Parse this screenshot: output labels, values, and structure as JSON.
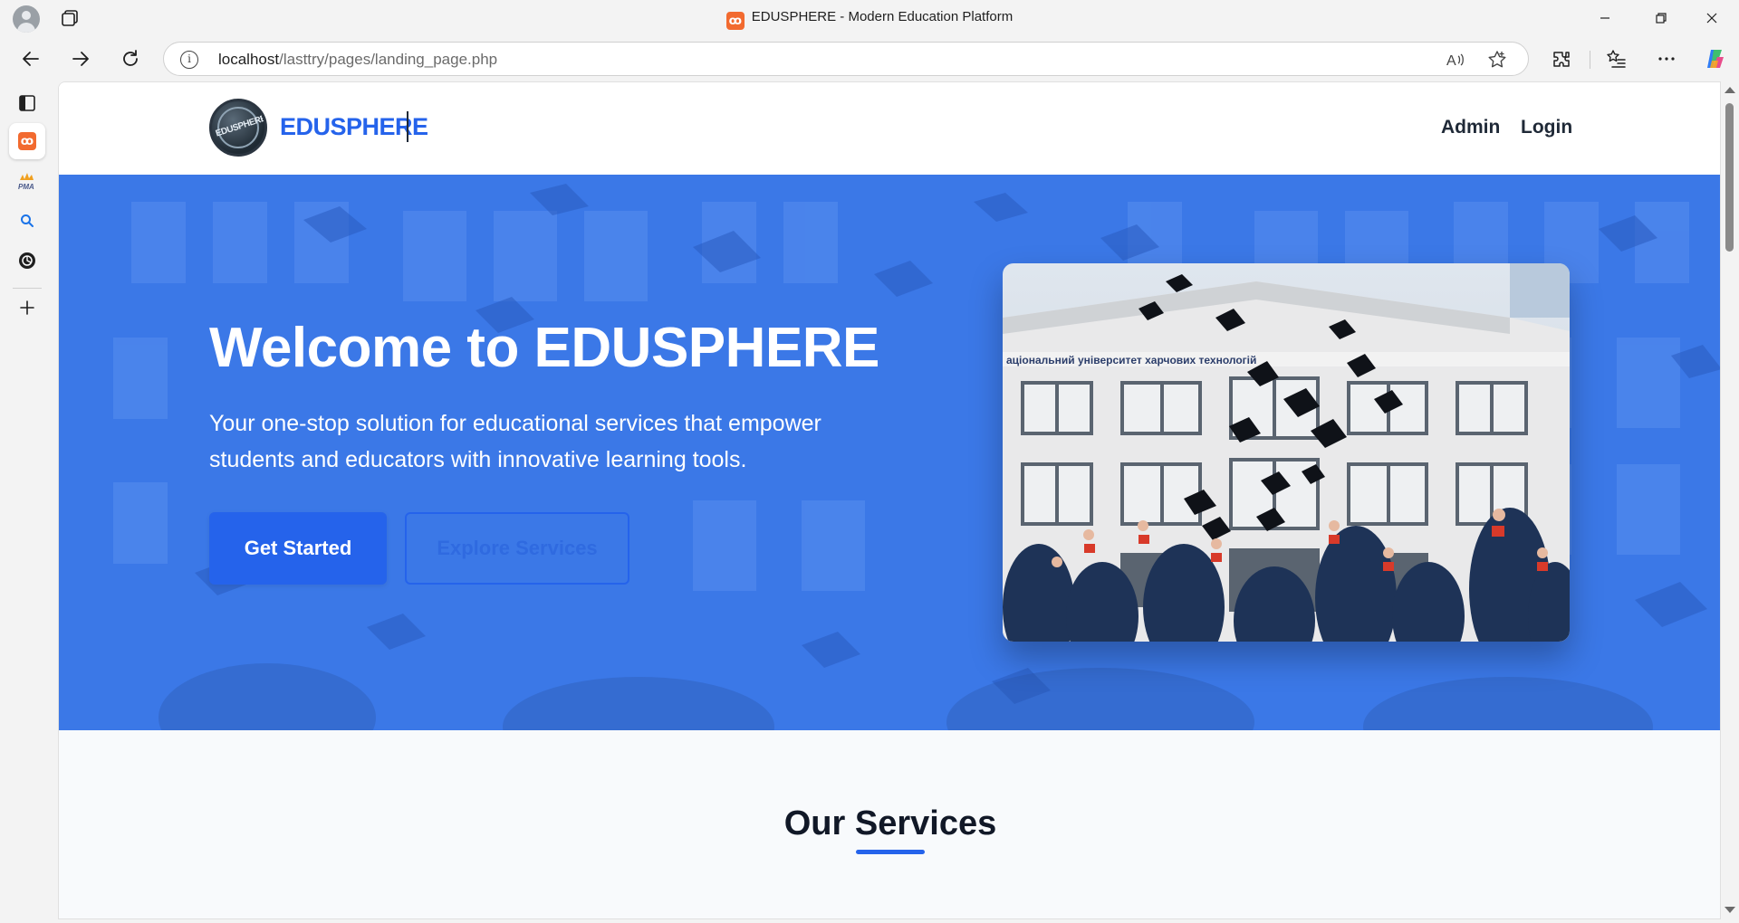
{
  "browser": {
    "window_title": "EDUSPHERE - Modern Education Platform",
    "url_host": "localhost",
    "url_path": "/lasttry/pages/landing_page.php"
  },
  "sidebar": {
    "items": [
      "vertical-tabs",
      "xampp",
      "phpmyadmin",
      "search",
      "openai",
      "add"
    ]
  },
  "site": {
    "brand": "EDUSPHERE",
    "logo_text": "EDUSPHERE",
    "nav": [
      {
        "label": "Admin"
      },
      {
        "label": "Login"
      }
    ]
  },
  "hero": {
    "title": "Welcome to EDUSPHERE",
    "subtitle": "Your one-stop solution for educational services that empower students and educators with innovative learning tools.",
    "primary_button": "Get Started",
    "secondary_button": "Explore Services"
  },
  "services": {
    "title": "Our Services"
  },
  "colors": {
    "brand_blue": "#2563eb",
    "hero_blue": "#3b78e7",
    "heading_dark": "#111827",
    "page_bg": "#f8fafc"
  }
}
